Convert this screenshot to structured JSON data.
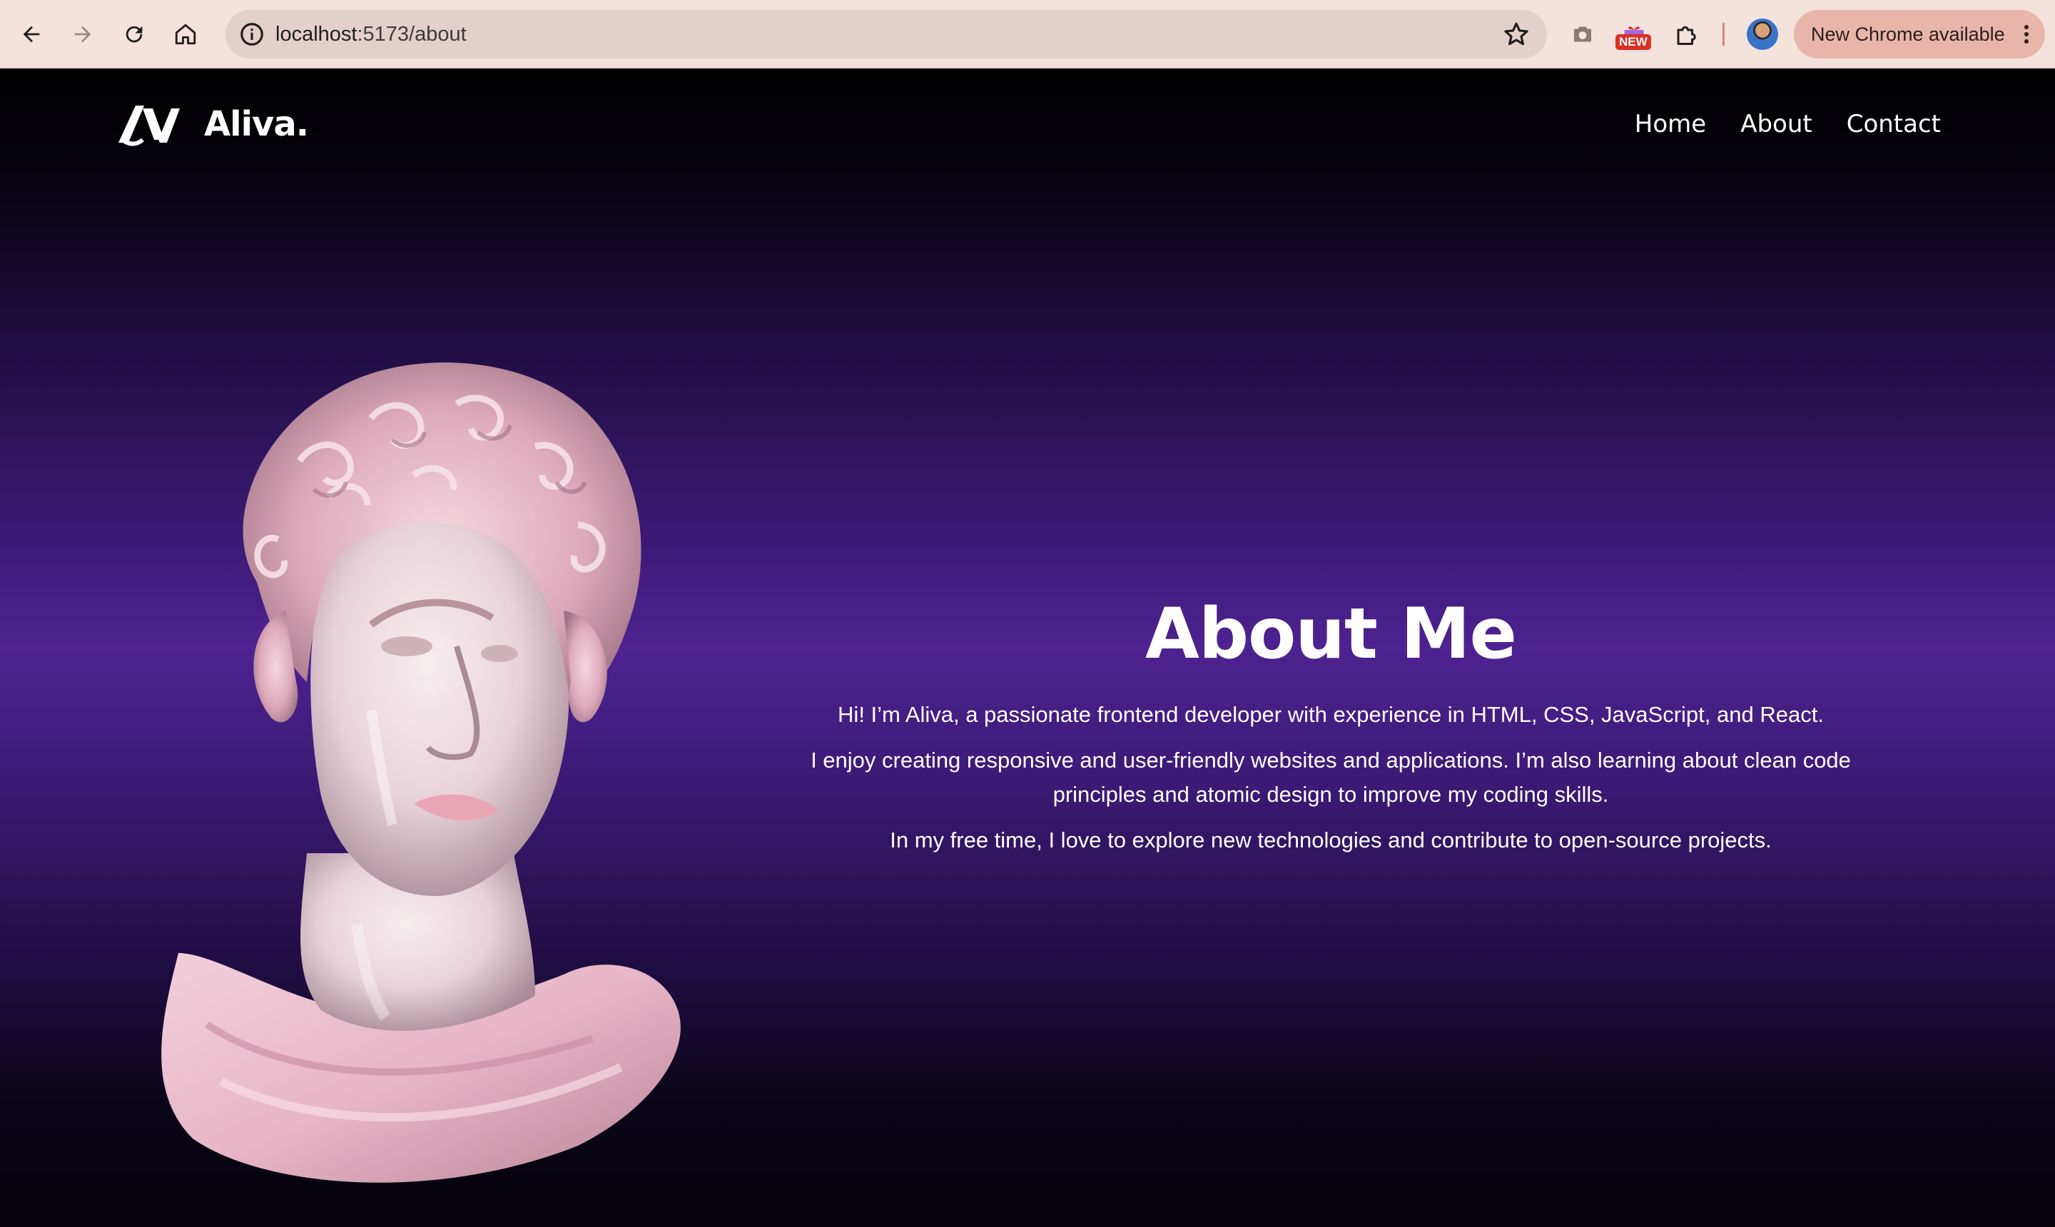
{
  "browser": {
    "url_host": "localhost",
    "url_path": ":5173/about",
    "new_badge": "NEW",
    "update_label": "New Chrome available"
  },
  "site": {
    "brand": "Aliva.",
    "nav": [
      {
        "label": "Home"
      },
      {
        "label": "About"
      },
      {
        "label": "Contact"
      }
    ]
  },
  "about": {
    "title": "About Me",
    "paragraphs": [
      "Hi! I’m Aliva, a passionate frontend developer with experience in HTML, CSS, JavaScript, and React.",
      "I enjoy creating responsive and user-friendly websites and applications. I’m also learning about clean code principles and atomic design to improve my coding skills.",
      "In my free time, I love to explore new technologies and contribute to open-source projects."
    ]
  },
  "icons": [
    "back-arrow-icon",
    "forward-arrow-icon",
    "reload-icon",
    "home-icon",
    "site-info-icon",
    "bookmark-star-icon",
    "camera-icon",
    "gift-icon",
    "extensions-icon",
    "profile-avatar",
    "kebab-menu-icon",
    "logo-icon",
    "bust-image"
  ],
  "colors": {
    "chrome_bg": "#f4e2dc",
    "omnibox_bg": "#e2d0ca",
    "update_pill": "#e8b6a8",
    "page_purple": "#4e2291",
    "page_dark": "#000000"
  }
}
